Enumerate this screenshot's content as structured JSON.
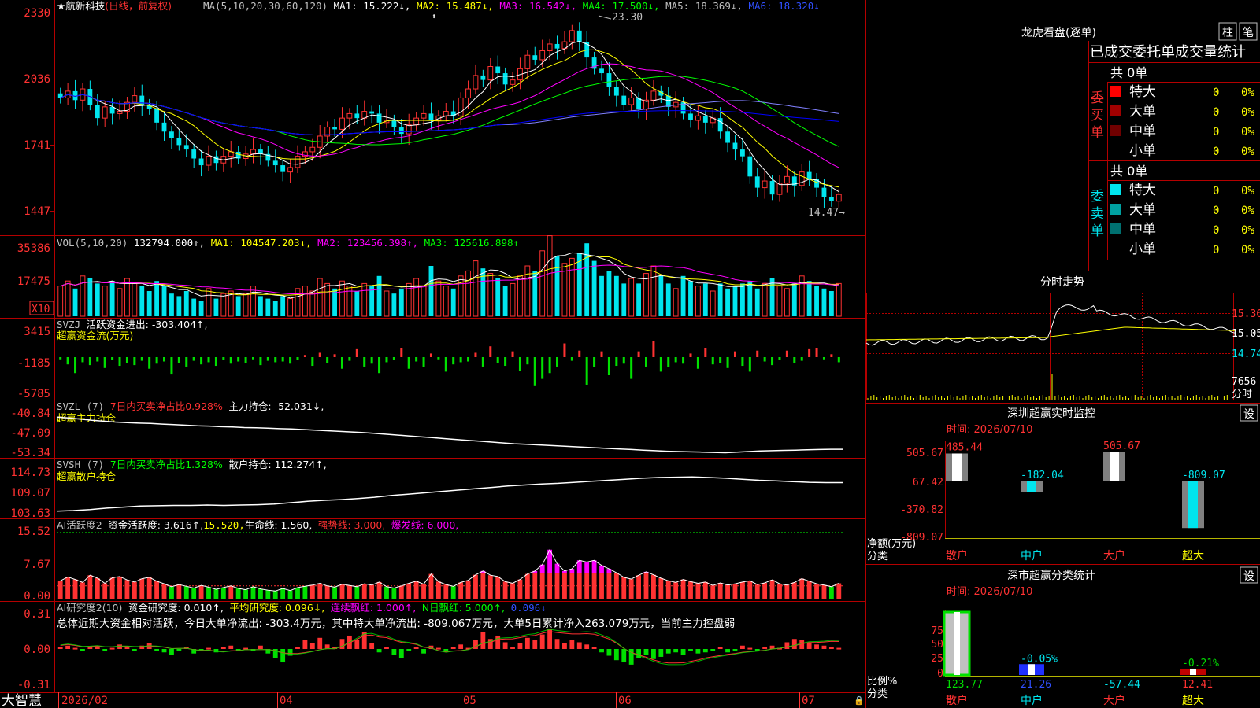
{
  "app": {
    "brand": "大智慧"
  },
  "colors": {
    "up": "#ff3232",
    "down": "#00e5ee",
    "grid": "#b40000",
    "ma1": "#ffffff",
    "ma2": "#ffff00",
    "ma3": "#ff00ff",
    "ma4": "#00ff00",
    "ma5": "#8080ff",
    "ma6": "#0000ff"
  },
  "header": {
    "star": "★",
    "name": "航新科技",
    "mode": "(日线，前复权)",
    "ma_label": "MA(5,10,20,30,60,120)",
    "ma1": "MA1: 15.222↓,",
    "ma2": "MA2: 15.487↓,",
    "ma3": "MA3: 16.542↓,",
    "ma4": "MA4: 17.500↓,",
    "ma5": "MA5: 18.369↓,",
    "ma6": "MA6: 18.320↓"
  },
  "main_ticks": [
    "2330",
    "2036",
    "1741",
    "1447"
  ],
  "annotations": {
    "high": "23.30",
    "low": "14.47→"
  },
  "vol_panel": {
    "label": "VOL(5,10,20)",
    "value": "132794.000↑,",
    "ma1": "MA1: 104547.203↓,",
    "ma2": "MA2: 123456.398↑,",
    "ma3": "MA3: 125616.898↑",
    "ticks": [
      "35386",
      "17475"
    ],
    "unit": "X10"
  },
  "svzj_panel": {
    "label": "SVZJ",
    "desc": "活跃资金进出: -303.404↑,",
    "sub": "超赢资金流(万元)",
    "ticks": [
      "3415",
      "-1185",
      "-5785"
    ]
  },
  "svzl_panel": {
    "label": "SVZL (7)",
    "desc1": "7日内买卖净占比0.928%",
    "desc2": "主力持仓: -52.031↓,",
    "sub": "超赢主力持仓",
    "ticks": [
      "-40.84",
      "-47.09",
      "-53.34"
    ]
  },
  "svsh_panel": {
    "label": "SVSH (7)",
    "desc1": "7日内买卖净占比1.328%",
    "desc2": "散户持仓: 112.274↑,",
    "sub": "超赢散户持仓",
    "ticks": [
      "114.73",
      "109.07",
      "103.63"
    ]
  },
  "ai1_panel": {
    "label": "AI活跃度2",
    "desc": "资金活跃度: 3.616↑,",
    "v2": "15.520,",
    "v3": "生命线: 1.560,",
    "v4": "强势线: 3.000,",
    "v5": "爆发线: 6.000,",
    "ticks": [
      "15.52",
      "7.67",
      "0.00"
    ]
  },
  "ai2_panel": {
    "label": "AI研究度2(10)",
    "desc": "资金研究度: 0.010↑,",
    "v2": "平均研究度: 0.096↓,",
    "v3": "连续飘红: 1.000↑,",
    "v4": "N日飘红: 5.000↑,",
    "v5": "0.096↓",
    "summary": "总体近期大资金相对活跃，今日大单净流出: -303.4万元，其中特大单净流出: -809.067万元，大单5日累计净入263.079万元，当前主力控盘弱",
    "ticks": [
      "0.31",
      "0.00",
      "-0.31"
    ]
  },
  "dates": [
    "2026/02",
    "04",
    "05",
    "06",
    "07"
  ],
  "right": {
    "lhb_title": "龙虎看盘(逐单)",
    "btn_zhu": "柱",
    "btn_bi": "笔",
    "tabs": "已成交委托单成交量统计",
    "buy_total": "共 0单",
    "sell_total": "共 0单",
    "buy_side": [
      "委",
      "买",
      "单"
    ],
    "sell_side": [
      "委",
      "卖",
      "单"
    ],
    "buy_rows": [
      {
        "name": "特大",
        "n": "0",
        "p": "0%"
      },
      {
        "name": "大单",
        "n": "0",
        "p": "0%"
      },
      {
        "name": "中单",
        "n": "0",
        "p": "0%"
      },
      {
        "name": "小单",
        "n": "0",
        "p": "0%"
      }
    ],
    "sell_rows": [
      {
        "name": "特大",
        "n": "0",
        "p": "0%"
      },
      {
        "name": "大单",
        "n": "0",
        "p": "0%"
      },
      {
        "name": "中单",
        "n": "0",
        "p": "0%"
      },
      {
        "name": "小单",
        "n": "0",
        "p": "0%"
      }
    ],
    "intraday_title": "分时走势",
    "intraday_ticks": [
      "15.36",
      "15.05",
      "14.74"
    ],
    "intraday_vol": [
      "7656",
      "分时"
    ],
    "sz_rt_title": "深圳超赢实时监控",
    "sz_cls_title": "深市超赢分类统计",
    "set_label": "设",
    "time_label": "时间: 2026/07/10",
    "net_label": [
      "净额(万元)",
      "分类"
    ],
    "ratio_label": [
      "比例%",
      "分类"
    ],
    "cats": [
      "散户",
      "中户",
      "大户",
      "超大"
    ],
    "rt_ticks": [
      "505.67",
      "67.42",
      "-370.82",
      "-809.07"
    ],
    "cls_ticks": [
      "75",
      "50",
      "25",
      "0"
    ]
  },
  "chart_data": [
    {
      "type": "candlestick",
      "title": "航新科技 (日线，前复权)",
      "ylim": [
        14.47,
        23.3
      ],
      "y_ticks": [
        23.3,
        20.36,
        17.41,
        14.47
      ],
      "high": 23.3,
      "low": 14.47,
      "ma_latest": {
        "MA1": 15.222,
        "MA2": 15.487,
        "MA3": 16.542,
        "MA4": 17.5,
        "MA5": 18.369,
        "MA6": 18.32
      },
      "closes": [
        19.5,
        19.8,
        19.4,
        19.9,
        19.2,
        18.6,
        19.1,
        18.8,
        18.9,
        19.3,
        19.6,
        19.2,
        19.0,
        18.4,
        18.0,
        17.7,
        17.4,
        17.2,
        16.8,
        16.5,
        16.9,
        16.6,
        16.9,
        17.1,
        16.8,
        17.0,
        17.2,
        17.0,
        16.7,
        16.5,
        16.2,
        16.4,
        16.9,
        17.1,
        17.3,
        17.8,
        18.2,
        18.1,
        18.6,
        18.8,
        18.6,
        18.9,
        18.8,
        18.4,
        18.5,
        18.2,
        17.9,
        18.3,
        18.6,
        18.8,
        18.5,
        18.7,
        18.9,
        18.7,
        19.5,
        19.9,
        20.5,
        20.3,
        20.9,
        20.6,
        20.1,
        20.3,
        20.8,
        21.4,
        21.2,
        21.6,
        21.9,
        21.7,
        22.0,
        22.5,
        22.0,
        21.3,
        20.8,
        20.6,
        20.0,
        19.6,
        19.2,
        19.5,
        19.0,
        19.4,
        19.8,
        19.6,
        19.1,
        19.3,
        18.8,
        18.5,
        18.7,
        18.4,
        18.6,
        18.0,
        17.5,
        17.2,
        16.9,
        16.0,
        15.5,
        15.8,
        15.2,
        15.7,
        16.0,
        15.6,
        16.2,
        15.9,
        15.5,
        15.1,
        14.9,
        15.2
      ]
    },
    {
      "type": "bar",
      "title": "VOL(5,10,20)",
      "y_ticks": [
        35386,
        17475
      ],
      "unit": "X10",
      "latest": 132794.0,
      "ma_latest": {
        "MA1": 104547.203,
        "MA2": 123456.398,
        "MA3": 125616.898
      },
      "values": [
        1.2,
        1.4,
        1.1,
        1.6,
        1.5,
        1.3,
        1.2,
        1.4,
        1.1,
        1.5,
        1.3,
        1.2,
        1.0,
        1.4,
        1.2,
        0.9,
        0.8,
        1.0,
        0.7,
        0.6,
        1.1,
        0.7,
        0.9,
        1.0,
        0.8,
        0.9,
        1.2,
        0.8,
        0.7,
        0.6,
        0.8,
        0.7,
        1.1,
        1.2,
        1.0,
        1.5,
        1.3,
        1.1,
        1.4,
        1.2,
        1.0,
        1.3,
        1.2,
        1.6,
        1.0,
        0.9,
        1.1,
        1.3,
        1.5,
        1.2,
        2.0,
        1.4,
        1.2,
        1.1,
        1.6,
        1.8,
        2.2,
        1.9,
        1.7,
        1.5,
        1.2,
        1.3,
        1.6,
        2.0,
        1.8,
        2.6,
        3.2,
        2.4,
        2.1,
        2.3,
        2.5,
        2.9,
        2.2,
        1.6,
        1.8,
        1.6,
        1.3,
        1.5,
        1.3,
        1.7,
        2.0,
        1.6,
        1.3,
        1.1,
        1.6,
        1.4,
        1.2,
        1.3,
        1.0,
        1.3,
        1.1,
        1.2,
        1.3,
        1.4,
        1.1,
        1.3,
        1.5,
        1.2,
        1.1,
        1.3,
        1.6,
        1.4,
        1.2,
        1.1,
        1.0,
        1.3
      ]
    },
    {
      "type": "bar",
      "title": "SVZJ 超赢资金流(万元)",
      "y_ticks": [
        3415,
        -1185,
        -5785
      ],
      "latest": -303.404,
      "values": [
        -300,
        -1000,
        -2200,
        -700,
        -1100,
        -600,
        -1500,
        -400,
        -1200,
        -800,
        -1100,
        -500,
        -1600,
        -900,
        -600,
        -2400,
        -800,
        -1300,
        -500,
        -1000,
        -700,
        -1200,
        -400,
        -900,
        -600,
        -800,
        -300,
        -1100,
        -500,
        -700,
        -600,
        -900,
        -400,
        300,
        -1200,
        600,
        -800,
        400,
        -1600,
        -500,
        1100,
        -1300,
        -900,
        -2200,
        -700,
        -400,
        1300,
        -1600,
        -600,
        -1400,
        500,
        -300,
        -2000,
        -1000,
        -700,
        -600,
        600,
        -1300,
        1500,
        -800,
        -1200,
        800,
        -1900,
        -1000,
        -4000,
        -3000,
        -2200,
        -1300,
        1900,
        -500,
        900,
        -3800,
        -1400,
        800,
        -2500,
        -1200,
        -900,
        -3000,
        800,
        -1300,
        2200,
        -2000,
        -1400,
        -700,
        -900,
        500,
        -1600,
        1300,
        -1000,
        -800,
        -1500,
        800,
        -1200,
        -2000,
        900,
        -600,
        -1100,
        -400,
        900,
        -800,
        -500,
        1100,
        1200,
        -300,
        400,
        -700
      ]
    },
    {
      "type": "line",
      "title": "SVZL (7) 超赢主力持仓",
      "y_ticks": [
        -40.84,
        -47.09,
        -53.34
      ],
      "latest": -52.031,
      "values": [
        -40.9,
        -41.2,
        -41.6,
        -42.0,
        -42.3,
        -42.6,
        -42.8,
        -43.0,
        -43.1,
        -43.3,
        -43.5,
        -43.7,
        -43.9,
        -44.0,
        -44.2,
        -44.3,
        -44.5,
        -44.6,
        -44.7,
        -44.9,
        -45.0,
        -45.2,
        -45.4,
        -45.6,
        -45.8,
        -46.0,
        -46.2,
        -46.5,
        -46.8,
        -47.1,
        -47.4,
        -47.7,
        -48.0,
        -48.3,
        -48.6,
        -48.9,
        -49.2,
        -49.5,
        -49.8,
        -50.1,
        -50.3,
        -50.5,
        -50.7,
        -50.9,
        -51.1,
        -51.3,
        -51.5,
        -51.7,
        -51.9,
        -52.1,
        -52.3,
        -52.5,
        -52.7,
        -52.8,
        -52.9,
        -53.0,
        -53.1,
        -53.2,
        -53.0,
        -52.8,
        -52.6,
        -52.5,
        -52.4,
        -52.3,
        -52.2,
        -52.1,
        -52.0,
        -52.0
      ]
    },
    {
      "type": "line",
      "title": "SVSH (7) 超赢散户持仓",
      "y_ticks": [
        114.73,
        109.07,
        103.63
      ],
      "latest": 112.274,
      "values": [
        103.9,
        104.1,
        104.4,
        104.8,
        105.1,
        105.4,
        105.5,
        105.6,
        105.6,
        105.7,
        105.6,
        105.7,
        105.8,
        106.0,
        106.4,
        106.8,
        107.1,
        107.3,
        107.6,
        108.0,
        108.5,
        108.9,
        109.3,
        109.7,
        110.1,
        110.5,
        110.9,
        111.3,
        111.6,
        111.9,
        112.1,
        112.4,
        112.7,
        113.0,
        113.3,
        113.6,
        113.8,
        113.9,
        114.0,
        113.8,
        113.6,
        113.3,
        113.0,
        112.8,
        112.6,
        112.4,
        112.3,
        112.3
      ]
    },
    {
      "type": "bar",
      "title": "AI活跃度2",
      "y_ticks": [
        15.52,
        7.67,
        0.0
      ],
      "latest": 3.616,
      "reference_lines": {
        "生命线": 1.56,
        "强势线": 3.0,
        "爆发线": 6.0,
        "top": 15.52
      },
      "values": [
        4.2,
        5.1,
        4.5,
        3.8,
        5.5,
        4.8,
        3.6,
        4.9,
        5.2,
        4.4,
        3.9,
        4.7,
        5.0,
        4.1,
        3.5,
        2.8,
        3.3,
        2.9,
        2.5,
        3.1,
        2.7,
        2.2,
        2.6,
        3.0,
        2.4,
        2.1,
        2.8,
        2.3,
        2.0,
        1.8,
        2.4,
        1.9,
        2.6,
        2.9,
        3.2,
        3.6,
        3.0,
        2.7,
        3.4,
        3.1,
        2.8,
        3.5,
        3.2,
        3.9,
        2.8,
        2.5,
        3.0,
        3.6,
        4.1,
        3.4,
        5.8,
        4.0,
        3.3,
        2.9,
        3.8,
        4.3,
        5.6,
        6.5,
        5.5,
        5.2,
        4.0,
        3.6,
        4.5,
        5.8,
        6.5,
        8.0,
        11.5,
        8.2,
        6.5,
        7.0,
        9.0,
        8.6,
        9.0,
        7.8,
        7.0,
        6.1,
        5.0,
        4.6,
        5.5,
        6.3,
        5.6,
        4.8,
        4.2,
        3.8,
        4.5,
        4.0,
        3.6,
        3.9,
        3.1,
        3.7,
        3.2,
        3.5,
        3.9,
        4.2,
        3.3,
        3.7,
        4.4,
        3.5,
        3.2,
        3.8,
        4.7,
        4.1,
        3.5,
        3.2,
        2.8,
        3.6
      ]
    },
    {
      "type": "bar",
      "title": "AI研究度2(10)",
      "y_ticks": [
        0.31,
        0.0,
        -0.31
      ],
      "latest": 0.01,
      "average": 0.096,
      "values": [
        0.02,
        0.03,
        0.01,
        -0.01,
        0.02,
        0.03,
        -0.02,
        0.01,
        0.04,
        0.02,
        -0.01,
        0.03,
        0.05,
        -0.02,
        -0.03,
        -0.05,
        -0.01,
        0.02,
        -0.04,
        -0.02,
        0.01,
        -0.03,
        0.02,
        0.03,
        -0.02,
        0.01,
        -0.02,
        0.03,
        -0.04,
        -0.08,
        -0.12,
        -0.06,
        0.02,
        0.08,
        0.05,
        0.1,
        0.04,
        0.02,
        0.09,
        0.12,
        0.08,
        0.15,
        0.05,
        -0.03,
        0.02,
        -0.05,
        -0.08,
        -0.02,
        0.02,
        -0.04,
        0.03,
        0.01,
        -0.02,
        0.02,
        0.04,
        0.01,
        0.08,
        0.15,
        0.09,
        0.12,
        0.06,
        0.02,
        0.05,
        0.1,
        0.08,
        0.13,
        0.18,
        0.09,
        0.05,
        0.08,
        0.06,
        0.04,
        0.02,
        -0.03,
        -0.06,
        -0.1,
        -0.12,
        -0.14,
        -0.08,
        -0.05,
        -0.09,
        -0.07,
        -0.04,
        -0.03,
        -0.05,
        -0.02,
        -0.04,
        -0.03,
        -0.01,
        0.02,
        -0.03,
        -0.02,
        0.03,
        0.01,
        -0.02,
        0.02,
        0.03,
        0.01,
        0.06,
        0.09,
        0.08,
        0.05,
        0.04,
        0.03,
        0.02,
        0.01
      ]
    },
    {
      "type": "bar",
      "title": "深圳超赢实时监控",
      "categories": [
        "散户",
        "中户",
        "大户",
        "超大"
      ],
      "values": [
        485.44,
        -182.04,
        505.67,
        -809.07
      ],
      "y_ticks": [
        505.67,
        67.42,
        -370.82,
        -809.07
      ]
    },
    {
      "type": "bar",
      "title": "深市超赢分类统计",
      "categories": [
        "散户",
        "中户",
        "大户",
        "超大"
      ],
      "values": [
        123.77,
        21.26,
        -57.44,
        12.41
      ],
      "bar_labels": [
        "",
        "-0.05%",
        "",
        "-0.21%"
      ],
      "y_ticks": [
        75,
        50,
        25,
        0
      ]
    }
  ]
}
